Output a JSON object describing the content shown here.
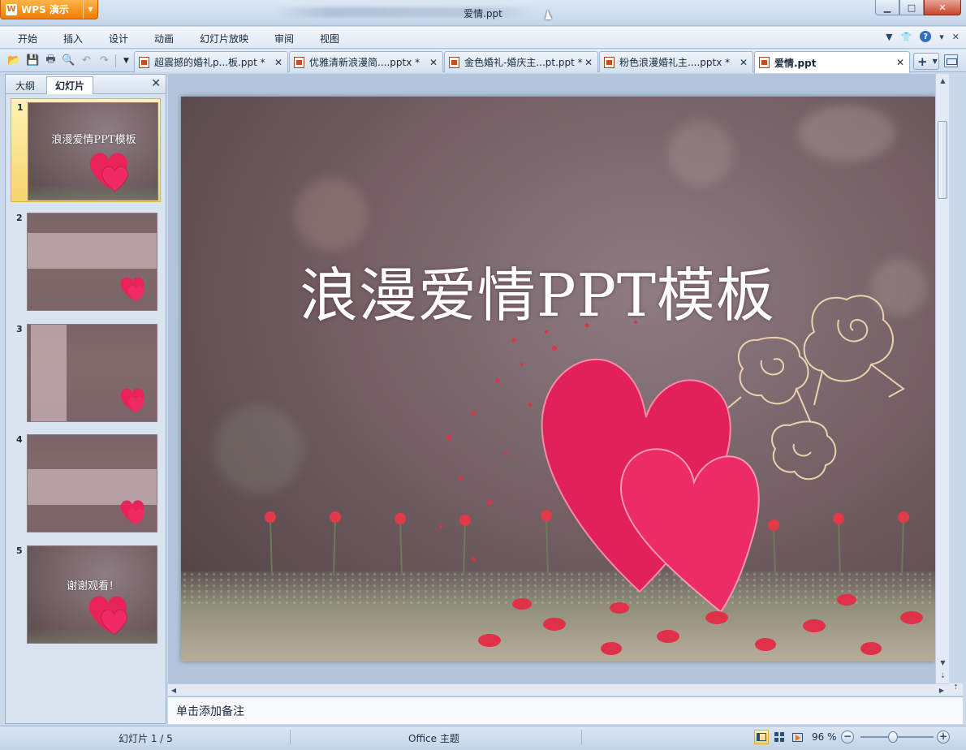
{
  "app": {
    "name": "WPS 演示",
    "window_title": "爱情.ppt"
  },
  "menu": [
    "开始",
    "插入",
    "设计",
    "动画",
    "幻灯片放映",
    "审阅",
    "视图"
  ],
  "tabs": [
    {
      "label": "超震撼的婚礼p...板.ppt *"
    },
    {
      "label": "优雅清新浪漫简....pptx *"
    },
    {
      "label": "金色婚礼-婚庆主...pt.ppt *"
    },
    {
      "label": "粉色浪漫婚礼主....pptx *"
    },
    {
      "label": "爱情.ppt"
    }
  ],
  "panel": {
    "tab_outline": "大纲",
    "tab_slides": "幻灯片"
  },
  "thumbnails": [
    {
      "num": "1",
      "text": "浪漫爱情PPT模板"
    },
    {
      "num": "2",
      "text": ""
    },
    {
      "num": "3",
      "text": ""
    },
    {
      "num": "4",
      "text": ""
    },
    {
      "num": "5",
      "text": "谢谢观看！"
    }
  ],
  "slide": {
    "title": "浪漫爱情PPT模板"
  },
  "notes": {
    "placeholder": "单击添加备注"
  },
  "status": {
    "slide": "幻灯片 1 / 5",
    "theme": "Office 主题",
    "zoom": "96 %"
  },
  "colors": {
    "accent": "#f08a14",
    "heart": "#e8235a",
    "frame": "#c9d8ea"
  }
}
